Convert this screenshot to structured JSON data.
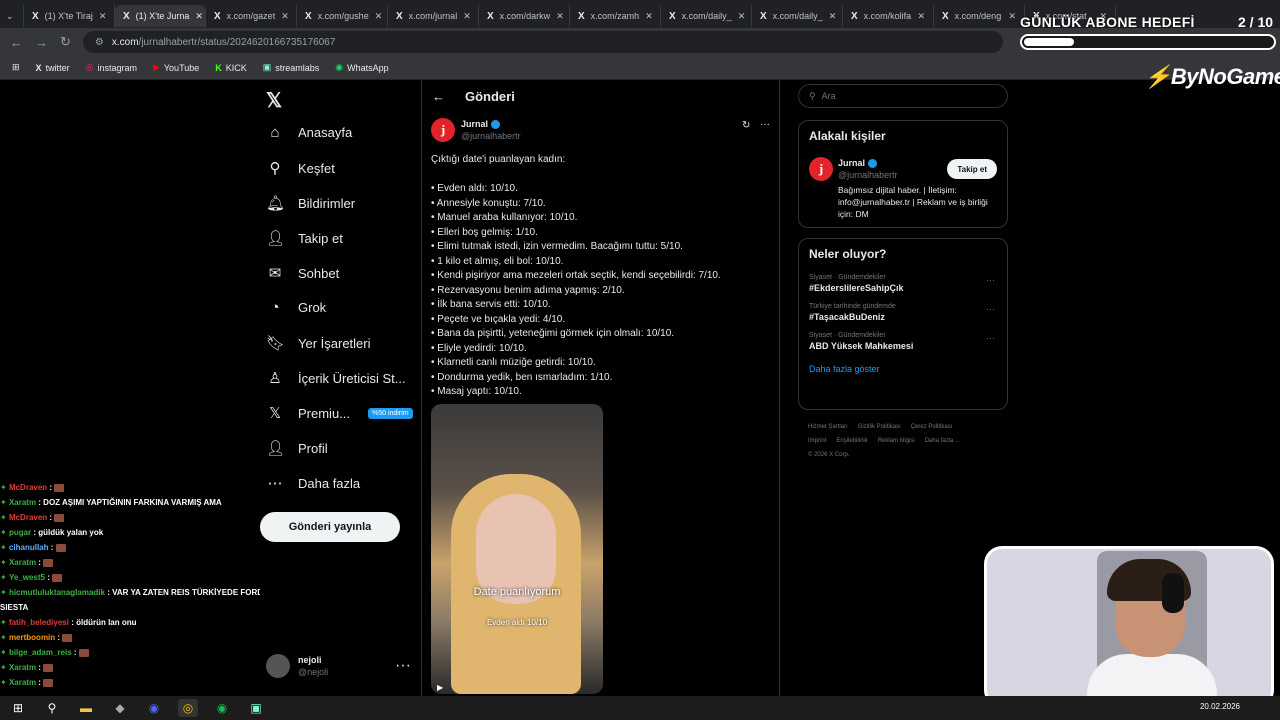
{
  "browser": {
    "tabs": [
      {
        "label": "(1) X'te Tiraj"
      },
      {
        "label": "(1) X'te Jurna"
      },
      {
        "label": "x.com/gazet"
      },
      {
        "label": "x.com/gushe"
      },
      {
        "label": "x.com/jurnal"
      },
      {
        "label": "x.com/darkw"
      },
      {
        "label": "x.com/zamh"
      },
      {
        "label": "x.com/daily_"
      },
      {
        "label": "x.com/daily_"
      },
      {
        "label": "x.com/kolifa"
      },
      {
        "label": "x.com/deng"
      },
      {
        "label": "x.com/stat"
      }
    ],
    "url_host": "x.com",
    "url_path": "/jurnalhabertr/status/2024620166735176067",
    "bookmarks": [
      {
        "label": "twitter"
      },
      {
        "label": "instagram"
      },
      {
        "label": "YouTube"
      },
      {
        "label": "KICK"
      },
      {
        "label": "streamlabs"
      },
      {
        "label": "WhatsApp"
      }
    ]
  },
  "overlay": {
    "goal_title": "GÜNLÜK ABONE HEDEFİ",
    "goal_count": "2 / 10",
    "goal_progress": 0.2,
    "brand_prefix": "By",
    "brand_name": "NoGame"
  },
  "nav": {
    "items": [
      {
        "label": "Anasayfa",
        "icon": "home-icon"
      },
      {
        "label": "Keşfet",
        "icon": "search-icon"
      },
      {
        "label": "Bildirimler",
        "icon": "bell-icon"
      },
      {
        "label": "Takip et",
        "icon": "follow-icon"
      },
      {
        "label": "Sohbet",
        "icon": "mail-icon"
      },
      {
        "label": "Grok",
        "icon": "grok-icon"
      },
      {
        "label": "Yer İşaretleri",
        "icon": "bookmark-icon"
      },
      {
        "label": "İçerik Üreticisi St...",
        "icon": "creator-icon"
      },
      {
        "label": "Premiu...",
        "icon": "x-logo-icon"
      },
      {
        "label": "Profil",
        "icon": "person-icon"
      },
      {
        "label": "Daha fazla",
        "icon": "more-icon"
      }
    ],
    "premium_badge": "%50 indirim",
    "post_button": "Gönderi yayınla",
    "account_name": "nejoli",
    "account_handle": "@nejoli"
  },
  "post": {
    "header": "Gönderi",
    "author_name": "Jurnal",
    "author_handle": "@jurnalhabertr",
    "intro": "Çıktığı date'i puanlayan kadın:",
    "lines": [
      "• Evden aldı: 10/10.",
      "• Annesiyle konuştu: 7/10.",
      "• Manuel araba kullanıyor: 10/10.",
      "• Elleri boş gelmiş: 1/10.",
      "• Elimi tutmak istedi, izin vermedim. Bacağımı tuttu: 5/10.",
      "• 1 kilo et almış, eli bol: 10/10.",
      "• Kendi pişiriyor ama mezeleri ortak seçtik, kendi seçebilirdi: 7/10.",
      "• Rezervasyonu benim adıma yapmış: 2/10.",
      "• İlk bana servis etti: 10/10.",
      "• Peçete ve bıçakla yedi: 4/10.",
      "• Bana da pişirtti, yeteneğimi görmek için olmalı: 10/10.",
      "• Eliyle yedirdi: 10/10.",
      "• Klarnetli canlı müziğe getirdi: 10/10.",
      "• Dondurma yedik, ben ısmarladım: 1/10.",
      "• Masaj yaptı: 10/10."
    ],
    "video_caption": "Date puanlıyorum",
    "video_subcaption": "Evden aldı 10/10"
  },
  "sidebar": {
    "search_placeholder": "Ara",
    "related_title": "Alakalı kişiler",
    "related_name": "Jurnal",
    "related_handle": "@jurnalhabertr",
    "follow_label": "Takip et",
    "related_bio": "Bağımsız dijital haber. | İletişim: info@jurnalhaber.tr | Reklam ve iş birliği için: DM",
    "trends_title": "Neler oluyor?",
    "trends": [
      {
        "category": "Siyaset · Gündemdekiler",
        "tag": "#EkderslilereSahipÇık"
      },
      {
        "category": "Türkiye tarihinde gündemde",
        "tag": "#TaşacakBuDeniz"
      },
      {
        "category": "Siyaset · Gündemdekiler",
        "tag": "ABD Yüksek Mahkemesi"
      }
    ],
    "show_more": "Daha fazla göster",
    "footer_links": [
      "Hizmet Şartları",
      "Gizlilik Politikası",
      "Çerez Politikası",
      "Imprint",
      "Erişilebilirlik",
      "Reklam bilgisi",
      "Daha fazla ..."
    ],
    "copyright": "© 2026 X Corp."
  },
  "chat": [
    {
      "user": "McDraven",
      "msg": "",
      "color": "#e53935",
      "emote": true
    },
    {
      "user": "Xaratm",
      "msg": "DOZ AŞIMI YAPTIĞININ FARKINA VARMIŞ AMA",
      "color": "#3cb043",
      "emote": false
    },
    {
      "user": "McDraven",
      "msg": "",
      "color": "#e53935",
      "emote": true
    },
    {
      "user": "pugar",
      "msg": "güldük yalan yok",
      "color": "#3cb043",
      "emote": false
    },
    {
      "user": "cihanullah",
      "msg": "",
      "color": "#5ab0ff",
      "emote": true
    },
    {
      "user": "Xaratm",
      "msg": "",
      "color": "#3cb043",
      "emote": true
    },
    {
      "user": "Ye_west5",
      "msg": "",
      "color": "#3cb043",
      "emote": true
    },
    {
      "user": "hicmutluluktanaglamadik",
      "msg": "VAR YA ZATEN REIS TÜRKİYEDE FORD",
      "color": "#3cb043",
      "emote": false
    },
    {
      "user": "",
      "msg": "SIESTA",
      "color": "#fff",
      "emote": false
    },
    {
      "user": "fatih_belediyesi",
      "msg": "öldürün lan onu",
      "color": "#e53935",
      "emote": false
    },
    {
      "user": "mertboomin",
      "msg": "",
      "color": "#ff9800",
      "emote": true
    },
    {
      "user": "bilge_adam_reis",
      "msg": "",
      "color": "#3cb043",
      "emote": true
    },
    {
      "user": "Xaratm",
      "msg": "",
      "color": "#3cb043",
      "emote": true
    },
    {
      "user": "Xaratm",
      "msg": "",
      "color": "#3cb043",
      "emote": true
    }
  ],
  "taskbar": {
    "date": "20.02.2026"
  }
}
